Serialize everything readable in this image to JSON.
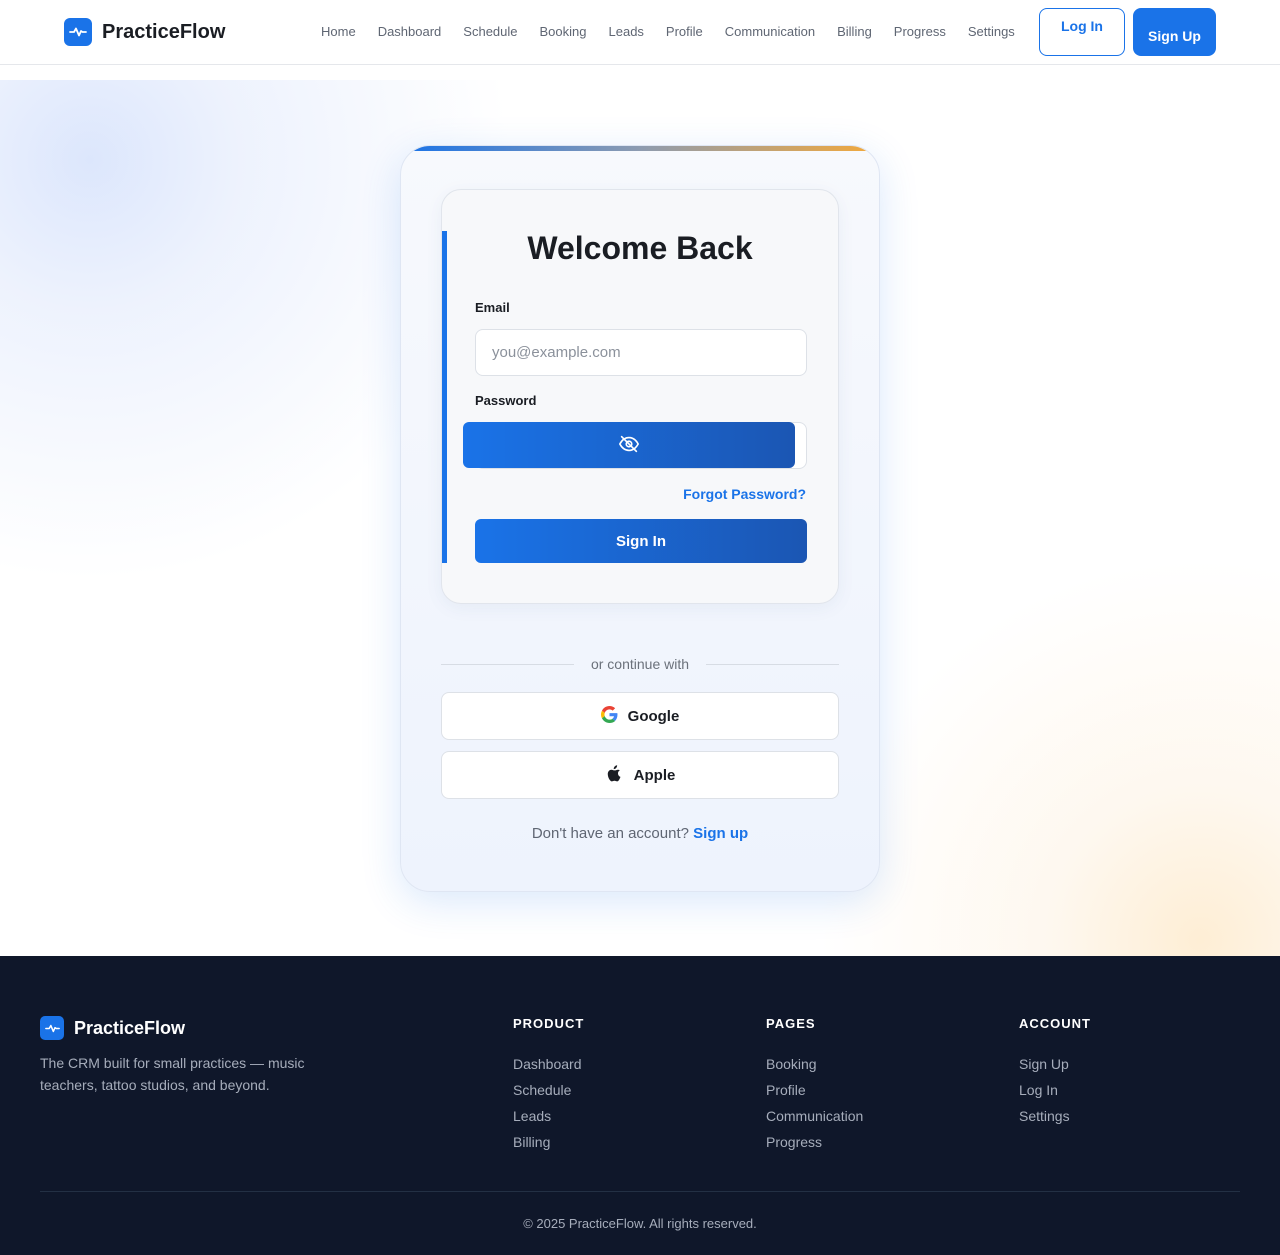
{
  "header": {
    "brand": "PracticeFlow",
    "nav": [
      "Home",
      "Dashboard",
      "Schedule",
      "Booking",
      "Leads",
      "Profile",
      "Communication",
      "Billing",
      "Progress",
      "Settings"
    ],
    "login_label": "Log In",
    "signup_label": "Sign Up"
  },
  "login": {
    "title": "Welcome Back",
    "email_label": "Email",
    "email_placeholder": "you@example.com",
    "password_label": "Password",
    "forgot_label": "Forgot Password?",
    "signin_label": "Sign In",
    "divider_text": "or continue with",
    "google_label": "Google",
    "apple_label": "Apple",
    "no_account_text": "Don't have an account?",
    "signup_link": "Sign up"
  },
  "footer": {
    "brand": "PracticeFlow",
    "description": "The CRM built for small practices — music teachers, tattoo studios, and beyond.",
    "columns": [
      {
        "title": "PRODUCT",
        "links": [
          "Dashboard",
          "Schedule",
          "Leads",
          "Billing"
        ]
      },
      {
        "title": "PAGES",
        "links": [
          "Booking",
          "Profile",
          "Communication",
          "Progress"
        ]
      },
      {
        "title": "ACCOUNT",
        "links": [
          "Sign Up",
          "Log In",
          "Settings"
        ]
      }
    ],
    "copyright": "© 2025 PracticeFlow. All rights reserved."
  },
  "colors": {
    "accent": "#1a73e8",
    "footer_bg": "#0f172a",
    "warm_accent": "#f4a93a"
  },
  "icons": [
    "pulse-icon",
    "eye-off-icon",
    "google-icon",
    "apple-icon"
  ]
}
